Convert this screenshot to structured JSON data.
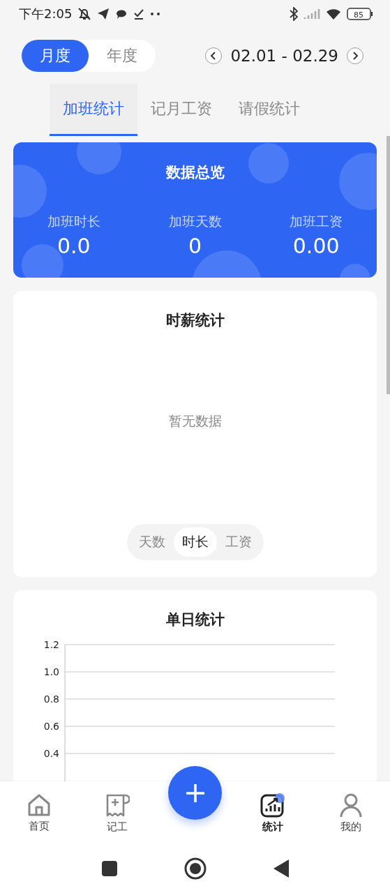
{
  "status_bar": {
    "time": "下午2:05",
    "battery": "85"
  },
  "period_toggle": [
    {
      "label": "月度",
      "selected": true
    },
    {
      "label": "年度",
      "selected": false
    }
  ],
  "date_range": "02.01 - 02.29",
  "tabs": [
    {
      "label": "加班统计",
      "selected": true
    },
    {
      "label": "记月工资",
      "selected": false
    },
    {
      "label": "请假统计",
      "selected": false
    }
  ],
  "overview": {
    "title": "数据总览",
    "stats": [
      {
        "label": "加班时长",
        "value": "0.0"
      },
      {
        "label": "加班天数",
        "value": "0"
      },
      {
        "label": "加班工资",
        "value": "0.00"
      }
    ]
  },
  "hourly": {
    "title": "时薪统计",
    "empty_text": "暂无数据",
    "segments": [
      {
        "label": "天数",
        "selected": false
      },
      {
        "label": "时长",
        "selected": true
      },
      {
        "label": "工资",
        "selected": false
      }
    ]
  },
  "daily": {
    "title": "单日统计",
    "axis_labels": [
      "1.2",
      "1.0",
      "0.8",
      "0.6",
      "0.4"
    ]
  },
  "bottom_nav": [
    {
      "label": "首页",
      "selected": false
    },
    {
      "label": "记工",
      "selected": false
    },
    {
      "label": "统计",
      "selected": true
    },
    {
      "label": "我的",
      "selected": false
    }
  ]
}
